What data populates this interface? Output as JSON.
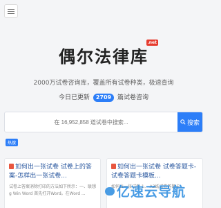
{
  "site": {
    "logo_text": "偶尔法律库",
    "logo_badge": ".net",
    "subtitle": "2000万试卷咨询库，覆盖所有试卷种类，极速查询",
    "daily_prefix": "今日已更新",
    "daily_count": "2709",
    "daily_suffix": "篇试卷咨询"
  },
  "search": {
    "placeholder": "在 16,952,858 道试卷中搜索...",
    "button_label": "搜索"
  },
  "hot_tag": "热搜",
  "cards": [
    {
      "title": "如何出一张试卷 试卷上的答案-怎样出一张试卷...",
      "excerpt": "试卷上答案消除打印的方法如下所示：一、联想g Win Word 首先打开Word。在Word ..."
    },
    {
      "title": "如何出一张试卷 试卷答题卡-试卷答题卡模板...",
      "excerpt": "如何出一张试卷 1、 A3纸试卷答题卡 ..."
    }
  ],
  "watermark": "亿速云导航",
  "colors": {
    "accent": "#2c7ef8",
    "badge": "#e63b2e"
  }
}
